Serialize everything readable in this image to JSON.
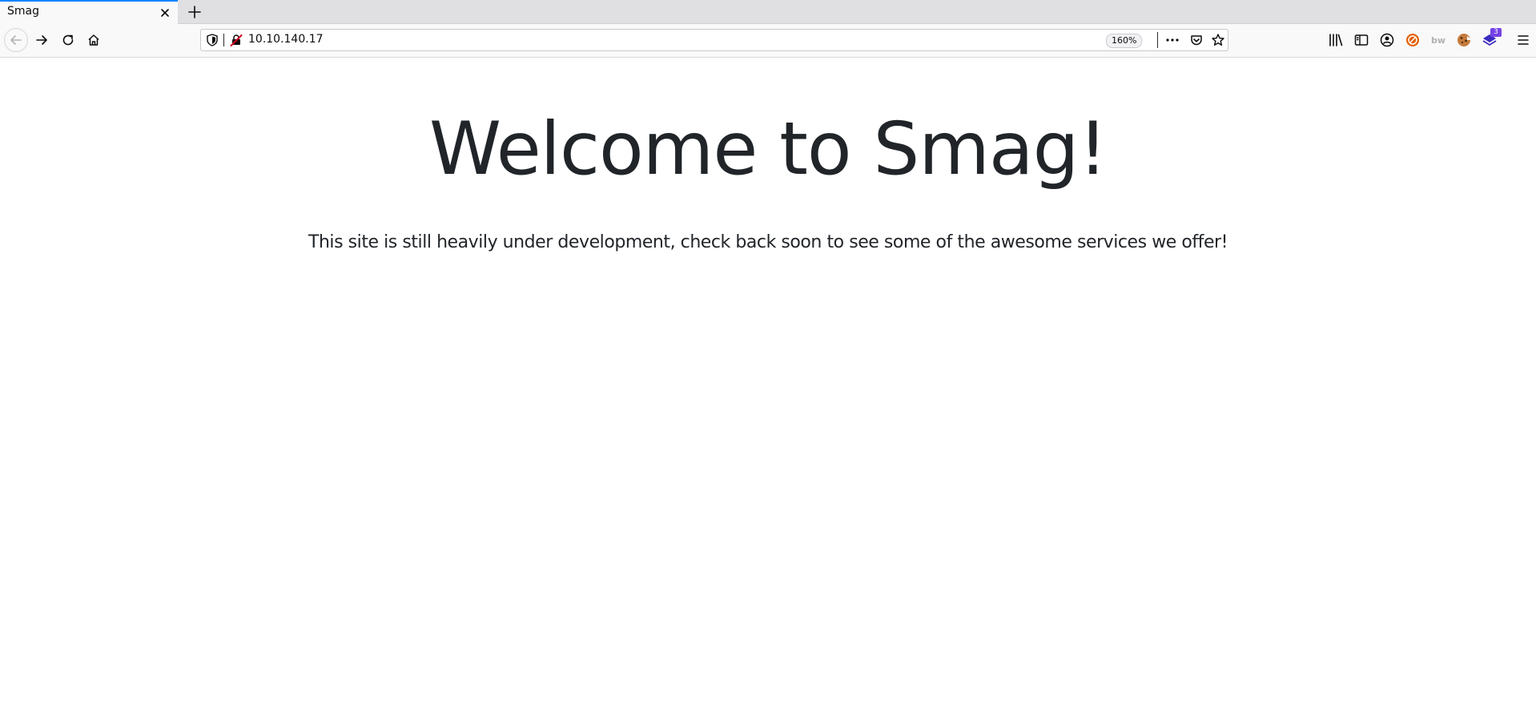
{
  "browser": {
    "tab": {
      "title": "Smag"
    },
    "urlbar": {
      "url": "10.10.140.17",
      "zoom": "160%"
    },
    "toolbar": {
      "extension_badge": "3"
    },
    "accent_color": "#0a84ff",
    "badge_color": "#7542e5"
  },
  "page": {
    "heading": "Welcome to Smag!",
    "subheading": "This site is still heavily under development, check back soon to see some of the awesome services we offer!"
  }
}
